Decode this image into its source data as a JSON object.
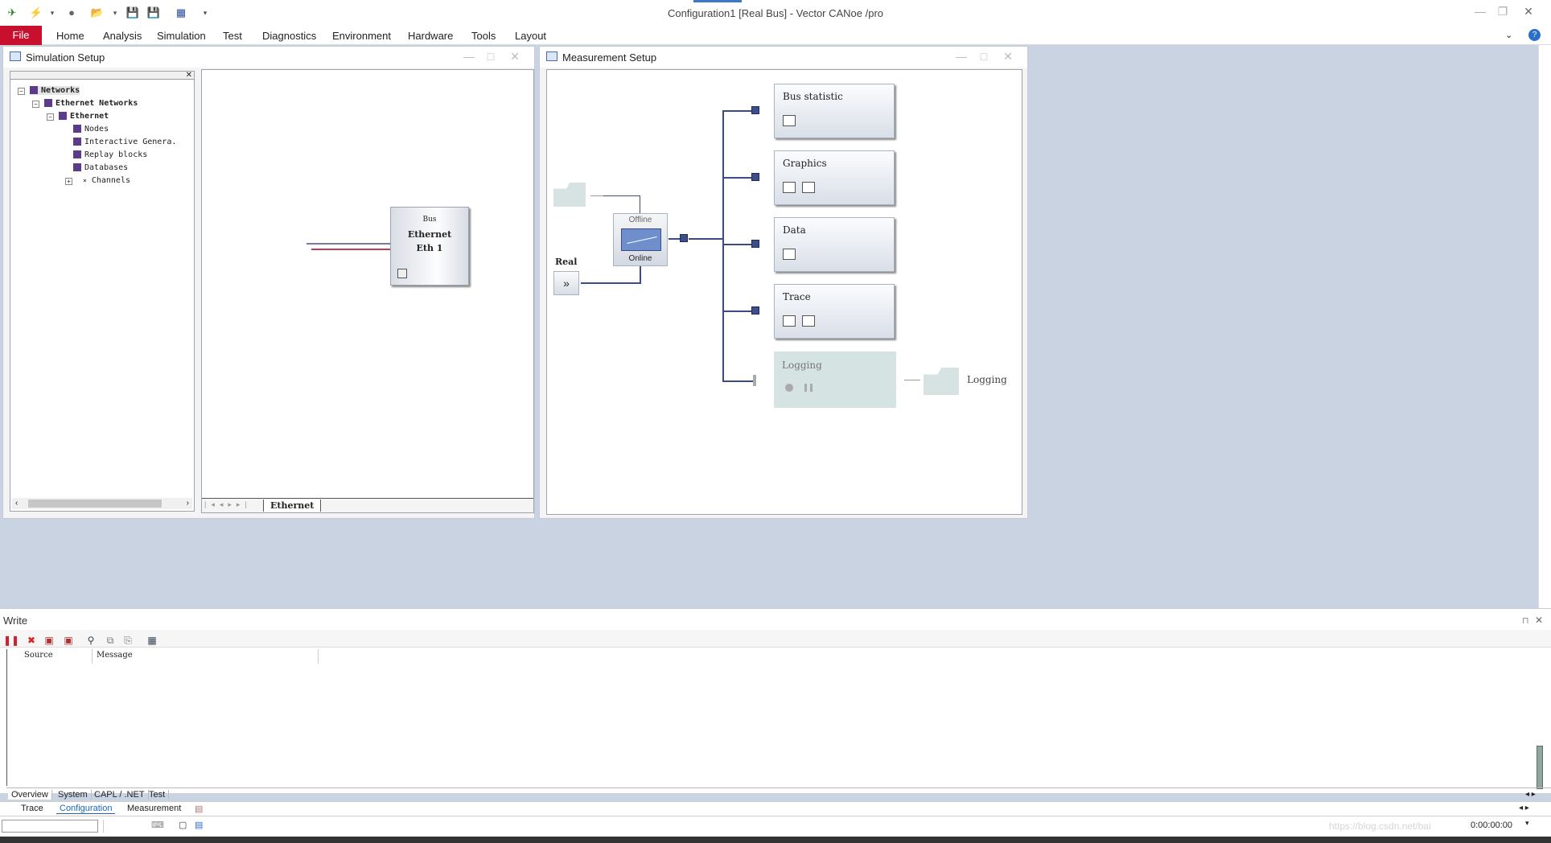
{
  "app": {
    "title": "Configuration1 [Real Bus] - Vector CANoe /pro"
  },
  "ribbon": {
    "file": "File",
    "tabs": [
      "Home",
      "Analysis",
      "Simulation",
      "Test",
      "Diagnostics",
      "Environment",
      "Hardware",
      "Tools",
      "Layout"
    ]
  },
  "simulation_setup": {
    "title": "Simulation Setup",
    "tree": {
      "networks": "Networks",
      "ethernet_networks": "Ethernet Networks",
      "ethernet": "Ethernet",
      "nodes": "Nodes",
      "interactive": "Interactive Genera.",
      "replay": "Replay blocks",
      "databases": "Databases",
      "channels": "Channels"
    },
    "bus_block": {
      "small": "Bus",
      "line1": "Ethernet",
      "line2": "Eth 1"
    },
    "tab": "Ethernet"
  },
  "measurement_setup": {
    "title": "Measurement Setup",
    "offline": "Offline",
    "online": "Online",
    "real": "Real",
    "blocks": {
      "bus_statistic": "Bus statistic",
      "graphics": "Graphics",
      "data": "Data",
      "trace": "Trace",
      "logging": "Logging",
      "logging_file": "Logging"
    }
  },
  "write": {
    "title": "Write",
    "columns": {
      "source": "Source",
      "message": "Message"
    },
    "tabs": [
      "Overview",
      "System",
      "CAPL / .NET",
      "Test"
    ]
  },
  "desktop_tabs": [
    "Trace",
    "Configuration",
    "Measurement"
  ],
  "status": {
    "time": "0:00:00:00",
    "watermark": "https://blog.csdn.net/bai"
  },
  "colors": {
    "file_tab": "#c8102e",
    "accent_blue": "#3c4a88",
    "active_tab": "#1f66b5"
  }
}
